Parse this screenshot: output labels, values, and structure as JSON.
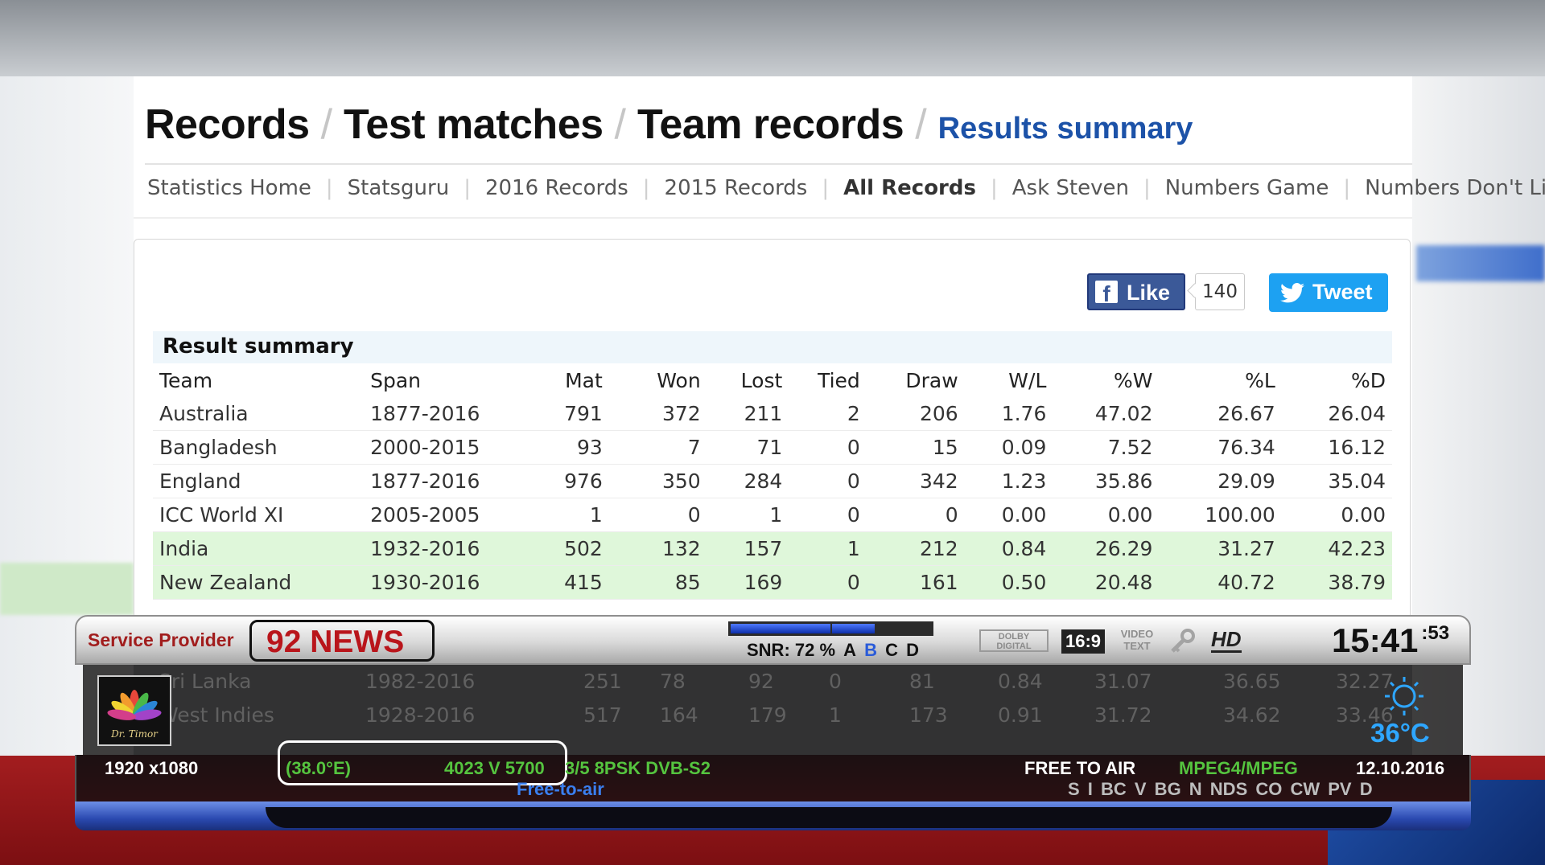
{
  "breadcrumb": {
    "items": [
      "Records",
      "Test matches",
      "Team records"
    ],
    "separator": "/",
    "current": "Results summary"
  },
  "subnav": {
    "items": [
      "Statistics Home",
      "Statsguru",
      "2016 Records",
      "2015 Records",
      "All Records",
      "Ask Steven",
      "Numbers Game",
      "Numbers Don't Li"
    ],
    "separator": "|",
    "active": "All Records"
  },
  "social": {
    "like_label": "Like",
    "like_count": "140",
    "tweet_label": "Tweet"
  },
  "results": {
    "heading": "Result summary",
    "columns": [
      "Team",
      "Span",
      "Mat",
      "Won",
      "Lost",
      "Tied",
      "Draw",
      "W/L",
      "%W",
      "%L",
      "%D"
    ],
    "rows": [
      {
        "cells": [
          "Australia",
          "1877-2016",
          "791",
          "372",
          "211",
          "2",
          "206",
          "1.76",
          "47.02",
          "26.67",
          "26.04"
        ],
        "highlight": false
      },
      {
        "cells": [
          "Bangladesh",
          "2000-2015",
          "93",
          "7",
          "71",
          "0",
          "15",
          "0.09",
          "7.52",
          "76.34",
          "16.12"
        ],
        "highlight": false
      },
      {
        "cells": [
          "England",
          "1877-2016",
          "976",
          "350",
          "284",
          "0",
          "342",
          "1.23",
          "35.86",
          "29.09",
          "35.04"
        ],
        "highlight": false
      },
      {
        "cells": [
          "ICC World XI",
          "2005-2005",
          "1",
          "0",
          "1",
          "0",
          "0",
          "0.00",
          "0.00",
          "100.00",
          "0.00"
        ],
        "highlight": false
      },
      {
        "cells": [
          "India",
          "1932-2016",
          "502",
          "132",
          "157",
          "1",
          "212",
          "0.84",
          "26.29",
          "31.27",
          "42.23"
        ],
        "highlight": true
      },
      {
        "cells": [
          "New Zealand",
          "1930-2016",
          "415",
          "85",
          "169",
          "0",
          "161",
          "0.50",
          "20.48",
          "40.72",
          "38.79"
        ],
        "highlight": true
      }
    ],
    "obscured_rows": [
      {
        "cells": [
          "Sri Lanka",
          "1982-2016",
          "251",
          "78",
          "92",
          "0",
          "81",
          "0.84",
          "31.07",
          "36.65",
          "32.27"
        ]
      },
      {
        "cells": [
          "West Indies",
          "1928-2016",
          "517",
          "164",
          "179",
          "1",
          "173",
          "0.91",
          "31.72",
          "34.62",
          "33.46"
        ]
      }
    ]
  },
  "osd": {
    "service_provider_label": "Service Provider",
    "channel_name": "92 NEWS",
    "signal_quality_percent": 72,
    "snr_text": "SNR: 72 %",
    "tuners": [
      "A",
      "B",
      "C",
      "D"
    ],
    "active_tuner": "B",
    "audio_badge": "DOLBY DIGITAL",
    "aspect_badge": "16:9",
    "teletext_badge": "VIDEO TEXT",
    "hd_badge": "HD",
    "time": "15:41",
    "seconds": ":53",
    "logo_text": "Dr. Timor",
    "temperature": "36°C",
    "resolution": "1920 x1080",
    "satellite_position": "(38.0°E)",
    "transponder": "4023 V 5700",
    "modulation": "3/5 8PSK DVB-S2",
    "fta_label": "Free-to-air",
    "free_to_air": "FREE TO AIR",
    "codec": "MPEG4/MPEG",
    "date": "12.10.2016",
    "ca_systems": "S  I BC V BG N  NDS CO CW PV D"
  },
  "colors": {
    "breadcrumb_current": "#1c52a8",
    "highlight_row": "#dff7da",
    "facebook": "#3b5998",
    "twitter": "#1da1f2",
    "channel_name": "#b9151b",
    "green_info": "#55c43f"
  }
}
